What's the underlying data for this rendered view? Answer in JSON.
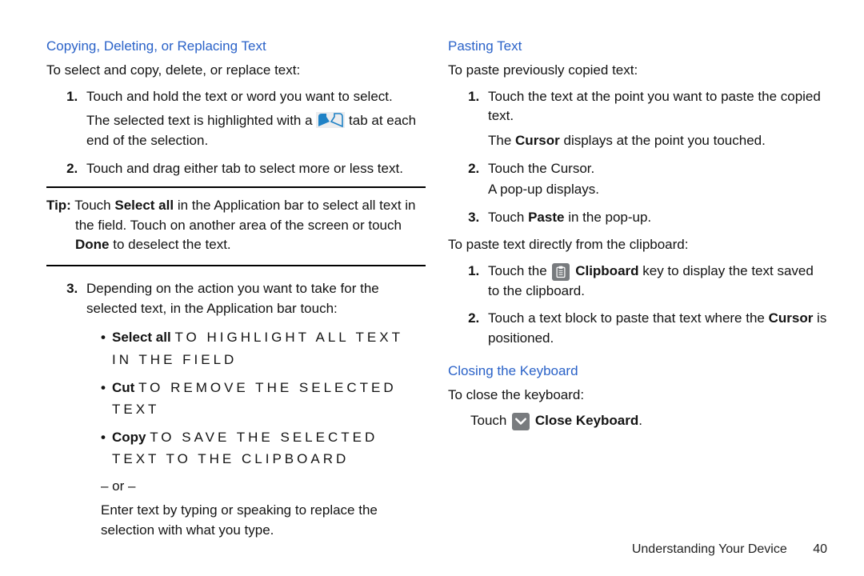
{
  "left": {
    "heading": "Copying, Deleting, or Replacing Text",
    "intro": "To select and copy, delete, or replace text:",
    "step1_a": "Touch and hold the text or word you want to select.",
    "step1_b_pre": "The selected text is highlighted with a ",
    "step1_b_post": " tab at each end of the selection.",
    "step2": "Touch and drag either tab to select more or less text.",
    "tip_label": "Tip:",
    "tip_a": " Touch ",
    "tip_select_all": "Select all",
    "tip_b": " in the Application bar to select all text in the field. Touch on another area of the screen or touch ",
    "tip_done": "Done",
    "tip_c": " to deselect the text.",
    "step3_intro": "Depending on the action you want to take for the selected text, in the Application bar touch:",
    "b1_label": "Select all",
    "b1_text": " to highlight all text in the field",
    "b2_label": "Cut",
    "b2_text": " to remove the selected text",
    "b3_label": "Copy",
    "b3_text": " to save the selected text to the clipboard",
    "or": "– or –",
    "step3_after": "Enter text by typing or speaking to replace the selection with what you type."
  },
  "right": {
    "pasting_heading": "Pasting Text",
    "pasting_intro": "To paste previously copied text:",
    "p_step1_a": "Touch the text at the point you want to paste the copied text.",
    "p_step1_b_pre": "The ",
    "p_step1_b_cursor": "Cursor",
    "p_step1_b_post": " displays at the point you touched.",
    "p_step2_a": "Touch the Cursor.",
    "p_step2_b": "A pop-up displays.",
    "p_step3_a": "Touch ",
    "p_step3_paste": "Paste",
    "p_step3_b": " in the pop-up.",
    "clip_intro": "To paste text directly from the clipboard:",
    "c_step1_a": "Touch the ",
    "c_step1_clip": " Clipboard",
    "c_step1_b": " key to display the text saved to the clipboard.",
    "c_step2_a": "Touch a text block to paste that text where the ",
    "c_step2_cursor": "Cursor",
    "c_step2_b": " is positioned.",
    "closing_heading": "Closing the Keyboard",
    "closing_intro": "To close the keyboard:",
    "close_step_prefix": "Touch ",
    "close_step_label": " Close Keyboard",
    "close_step_suffix": "."
  },
  "footer": {
    "section": "Understanding Your Device",
    "page": "40"
  }
}
